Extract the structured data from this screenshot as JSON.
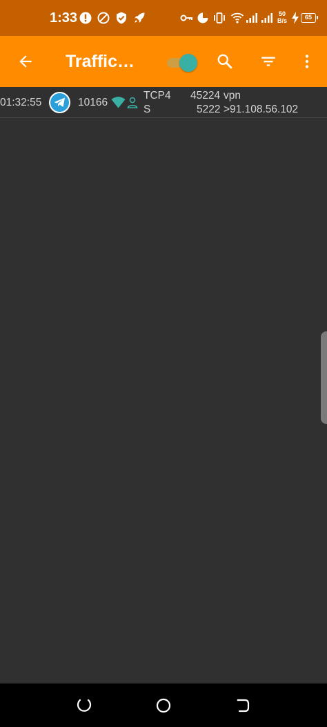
{
  "status_bar": {
    "time": "1:33",
    "net_speed_value": "50",
    "net_speed_unit": "B/s",
    "battery": "65",
    "icons": [
      "alert-icon",
      "do-not-disturb-icon",
      "shield-icon",
      "rocket-icon",
      "vpn-key-icon",
      "data-saver-icon",
      "vibrate-icon",
      "wifi-icon",
      "signal-icon",
      "signal-icon-2",
      "charging-icon"
    ]
  },
  "app_bar": {
    "title": "Traffic…",
    "back_icon": "back-arrow-icon",
    "toggle_on": true,
    "search_icon": "search-icon",
    "filter_icon": "filter-icon",
    "menu_icon": "more-vert-icon"
  },
  "colors": {
    "status_bar": "#c46000",
    "app_bar": "#ff8c00",
    "background": "#303030",
    "accent": "#3ab0a4",
    "text": "#d4d4d4"
  },
  "traffic": [
    {
      "time": "01:32:55",
      "app_icon": "telegram-icon",
      "uid": "10166",
      "network_icon": "wifi-icon",
      "user_icon": "person-icon",
      "protocol": "TCP4",
      "flags": "S",
      "source_port": "45224",
      "source_host": "vpn",
      "dest_port": "5222",
      "dest_host": ">91.108.56.102"
    }
  ],
  "nav_bar": {
    "buttons": [
      "recents-icon",
      "home-icon",
      "back-icon"
    ]
  }
}
